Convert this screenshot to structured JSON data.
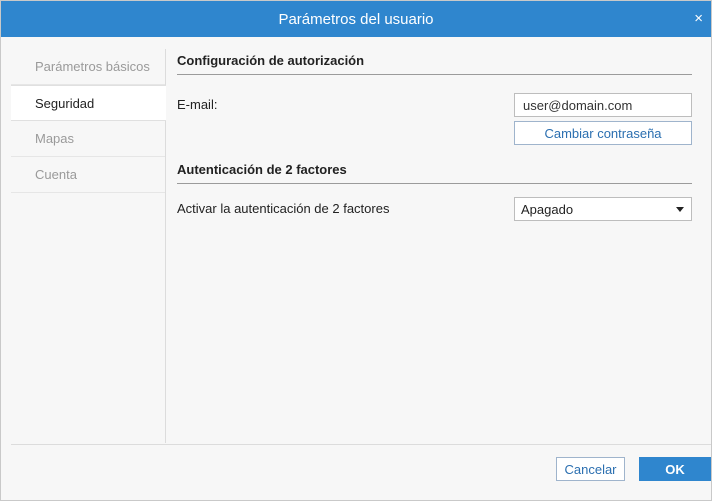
{
  "window": {
    "title": "Parámetros del usuario",
    "close_glyph": "×"
  },
  "sidebar": {
    "items": [
      {
        "label": "Parámetros básicos",
        "active": false
      },
      {
        "label": "Seguridad",
        "active": true
      },
      {
        "label": "Mapas",
        "active": false
      },
      {
        "label": "Cuenta",
        "active": false
      }
    ]
  },
  "auth": {
    "title": "Configuración de autorización",
    "email_label": "E-mail:",
    "email_value": "user@domain.com",
    "change_password_label": "Cambiar contraseña"
  },
  "twofa": {
    "title": "Autenticación de 2 factores",
    "enable_label": "Activar la autenticación de 2 factores",
    "selected_value": "Apagado"
  },
  "footer": {
    "cancel_label": "Cancelar",
    "ok_label": "OK"
  },
  "colors": {
    "accent": "#2f86ce",
    "link": "#2b6fb0"
  },
  "icons": {
    "close": "close-icon",
    "dropdown": "chevron-down-icon"
  }
}
